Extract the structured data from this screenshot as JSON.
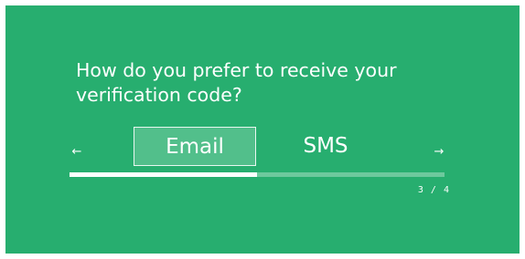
{
  "question": {
    "line1": "How do you prefer to receive your",
    "line2": "verification code?"
  },
  "nav": {
    "prev_icon": "left-arrow-icon",
    "prev_glyph": "←",
    "next_icon": "right-arrow-icon",
    "next_glyph": "→"
  },
  "options": [
    {
      "label": "Email",
      "selected": true
    },
    {
      "label": "SMS",
      "selected": false
    }
  ],
  "progress": {
    "current": 3,
    "total": 4,
    "text": "3 / 4",
    "fill_fraction": 0.5
  },
  "colors": {
    "background": "#27ae6f",
    "selected_option": "#52bf8b",
    "progress_track": "#6dc99d",
    "progress_fill": "#ffffff",
    "text": "#ffffff"
  }
}
